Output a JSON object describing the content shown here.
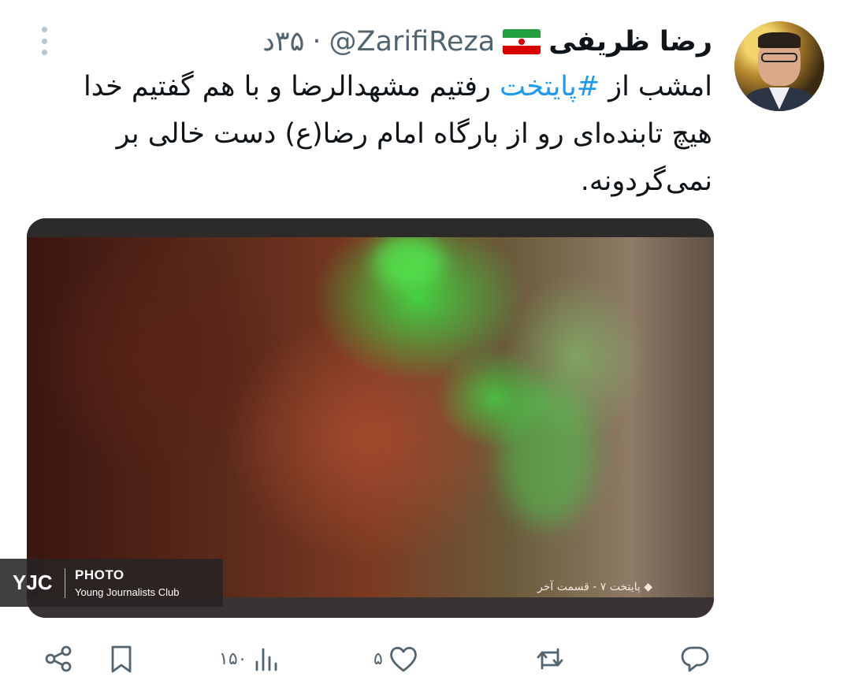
{
  "tweet": {
    "author_name": "رضا ظریفی",
    "handle": "@ZarifiReza",
    "separator": "·",
    "time": "۳۵د",
    "text_before_hashtag": "امشب از ",
    "hashtag": "#پایتخت",
    "text_after_hashtag": " رفتیم مشهدالرضا و با هم گفتیم خدا هیچ تابنده‌ای رو از بارگاه امام رضا(ع) دست خالی بر نمی‌گردونه."
  },
  "media": {
    "caption": "◆ پایتخت ۷ - قسمت آخر",
    "watermark_logo": "YJC",
    "watermark_title": "PHOTO",
    "watermark_subtitle": "Young Journalists Club"
  },
  "actions": {
    "views_count": "۱۵۰",
    "likes_count": "۵"
  },
  "colors": {
    "text": "#0f1419",
    "muted": "#536471",
    "link": "#1d9bf0"
  }
}
